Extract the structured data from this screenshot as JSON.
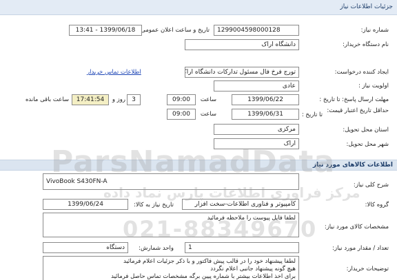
{
  "header": {
    "title": "جزئیات اطلاعات نیاز"
  },
  "fields": {
    "need_number": {
      "label": "شماره نیاز:",
      "value": "1299004598000128"
    },
    "announce_datetime": {
      "label": "تاریخ و ساعت اعلان عمومی:",
      "value": "1399/06/18 - 13:41"
    },
    "buyer_org": {
      "label": "نام دستگاه خریدار:",
      "value": "دانشگاه اراک"
    },
    "creator": {
      "label": "ایجاد کننده درخواست:",
      "value": "تورج فرخ فال مسئول تدارکات دانشگاه اراک"
    },
    "buyer_contact_link": "اطلاعات تماس خریدار",
    "priority": {
      "label": "اولویت نیاز :",
      "value": "عادی"
    },
    "reply_deadline": {
      "label": "مهلت ارسال پاسخ: تا تاریخ :",
      "date": "1399/06/22",
      "time_label": "ساعت",
      "time": "09:00",
      "days": "3",
      "days_label": "روز و",
      "remaining": "17:41:54",
      "remaining_label": "ساعت باقی مانده"
    },
    "price_validity": {
      "label": "حداقل تاریخ اعتبار قیمت:",
      "to_date_label": "تا تاریخ :",
      "date": "1399/06/31",
      "time_label": "ساعت",
      "time": "09:00"
    },
    "delivery_province": {
      "label": "استان محل تحویل:",
      "value": "مرکزی"
    },
    "delivery_city": {
      "label": "شهر محل تحویل:",
      "value": "اراک"
    }
  },
  "goods_section": {
    "title": "اطلاعات کالاهای مورد نیاز",
    "general_desc": {
      "label": "شرح کلی نیاز:",
      "value": "VivoBook S430FN-A"
    },
    "goods_group": {
      "label": "گروه کالا:",
      "value": "کامپیوتر و فناوری اطلاعات-سخت افزار",
      "need_date_label": "تاریخ نیاز به کالا:",
      "need_date": "1399/06/24"
    },
    "goods_spec": {
      "label": "مشخصات کالای مورد نیاز:",
      "value": "لطفا فایل پیوست را ملاحظه فرمائید"
    },
    "quantity": {
      "label": "تعداد / مقدار مورد نیاز:",
      "value": "1",
      "unit_label": "واحد شمارش:",
      "unit": "دستگاه"
    },
    "buyer_notes": {
      "label": "توضیحات خریدار:",
      "lines": [
        "لطفا پیشنهاد خود را در قالب پیش فاکتور و با ذکر جزئیات اعلام فرمائید",
        "هیچ گونه پیشنهاد جانبی اعلام نگردد",
        "برای اخذ اطلاعات بیشتر با شماره پیین برگه مشخصات تماس حاصل فرمائید"
      ]
    }
  },
  "watermarks": {
    "brand": "ParsNamadData",
    "slogan": "مرکز فراوری اطلاعات پارس نماد داده",
    "phone": "021-88349670"
  }
}
